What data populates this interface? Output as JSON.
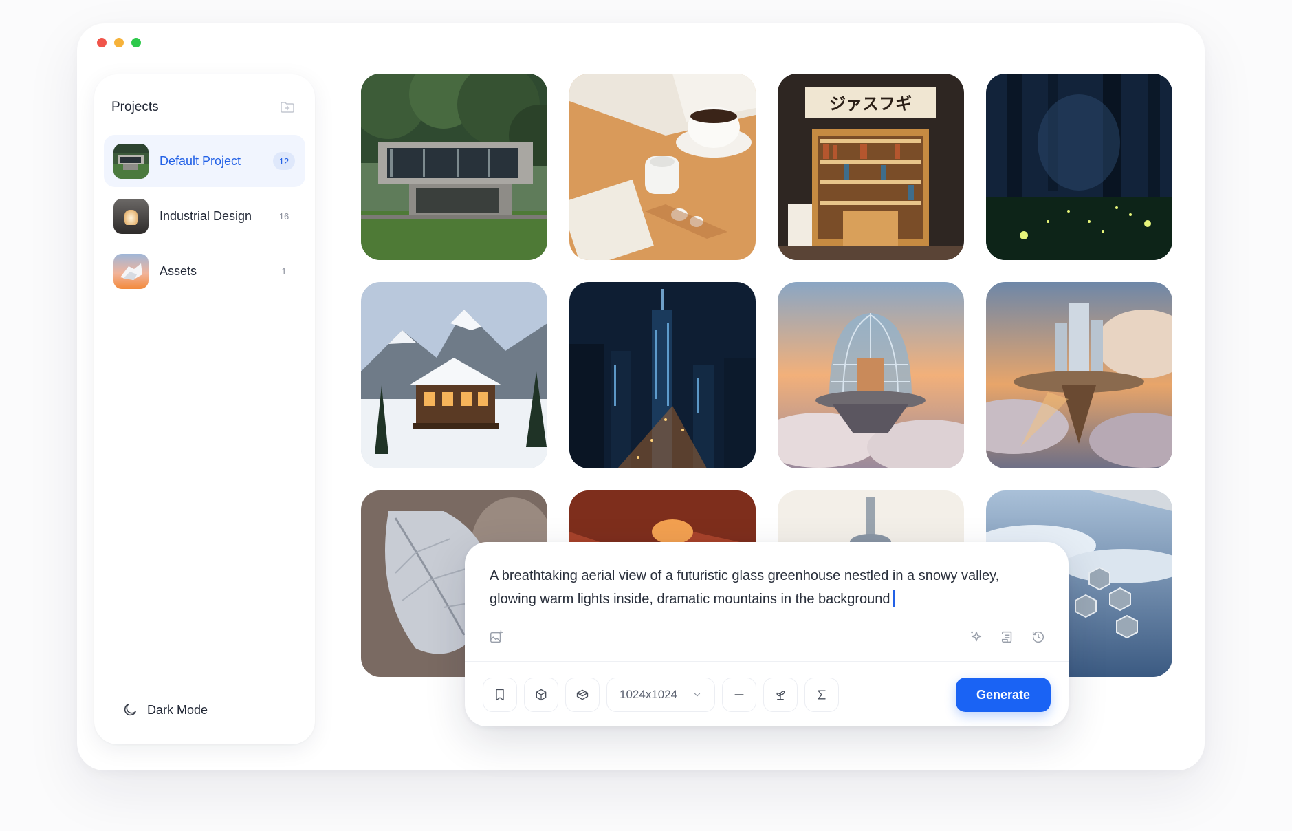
{
  "window": {
    "traffic_lights": [
      "close",
      "minimize",
      "maximize"
    ]
  },
  "sidebar": {
    "title": "Projects",
    "new_folder_icon": "folder-plus-icon",
    "projects": [
      {
        "name": "Default Project",
        "count": "12",
        "active": true
      },
      {
        "name": "Industrial Design",
        "count": "16",
        "active": false
      },
      {
        "name": "Assets",
        "count": "1",
        "active": false
      }
    ],
    "dark_mode_label": "Dark Mode"
  },
  "gallery": {
    "images": [
      "modern-concrete-house",
      "coffee-and-earbuds",
      "japanese-bookstore",
      "firefly-forest",
      "snowy-mountain-cabin",
      "night-city-skyline",
      "glass-dome-in-clouds",
      "floating-sky-city",
      "frosted-leaf",
      "red-canyon",
      "white-tower",
      "aerial-view-from-plane"
    ],
    "bookstore_sign": "ジァスフギ"
  },
  "composer": {
    "prompt": "A breathtaking aerial view of a futuristic glass greenhouse nestled in a snowy valley, glowing warm lights inside, dramatic mountains in the background",
    "size_value": "1024x1024",
    "generate_label": "Generate",
    "icons": [
      "image-add-icon",
      "sparkle-icon",
      "template-icon",
      "history-icon",
      "bookmark-icon",
      "cube-icon",
      "box-icon",
      "chevron-down-icon",
      "minus-icon",
      "seedling-icon",
      "sigma-icon"
    ]
  },
  "colors": {
    "accent": "#1a63f4",
    "active_bg": "#f1f5fe"
  }
}
